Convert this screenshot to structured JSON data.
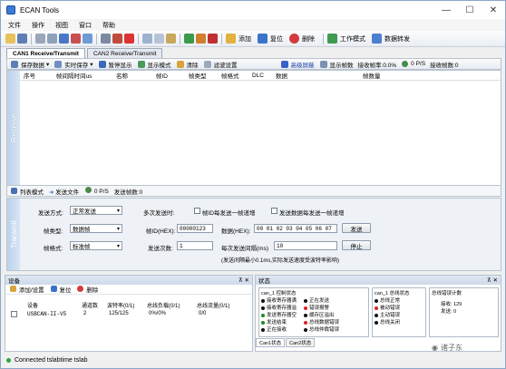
{
  "window": {
    "title": "ECAN Tools"
  },
  "menu": [
    "文件",
    "操作",
    "视图",
    "窗口",
    "帮助"
  ],
  "toolbar": {
    "add": "添加",
    "reset": "复位",
    "delete": "删除",
    "work_mode": "工作模式",
    "data_forward": "数据转发"
  },
  "tabs": [
    "CAN1 Receive/Transmit",
    "CAN2 Receive/Transmit"
  ],
  "rx_toolbar": {
    "save_data": "保存数据",
    "realtime_save": "实时保存",
    "pause_display": "暂停显示",
    "display_mode": "显示模式",
    "clear": "清除",
    "filter_settings": "滤波设置",
    "advanced_filter": "高级屏蔽",
    "display_frame": "显示帧数",
    "recv_fps": "接收帧率:0.0%",
    "rate": "0 P/S",
    "recv_count": "接收帧数:0"
  },
  "rx_side_label": "Receive",
  "rx_columns": [
    "序号",
    "帧间隔时间us",
    "名称",
    "帧ID",
    "帧类型",
    "帧格式",
    "DLC",
    "数据",
    "帧数量"
  ],
  "rx_status": {
    "list_mode": "列表模式",
    "send_file": "发送文件",
    "rate": "0 P/S",
    "send_count": "发送帧数:0"
  },
  "tx": {
    "side_label": "Transmit",
    "send_mode_label": "发送方式:",
    "send_mode_value": "正常发送",
    "multi_send_label": "多次发送时:",
    "chk_id_inc": "帧ID每发送一帧递增",
    "chk_data_inc": "发送数据每发送一帧递增",
    "frame_type_label": "帧类型:",
    "frame_type_value": "数据帧",
    "frame_id_label": "帧ID(HEX):",
    "frame_id_value": "00000123",
    "data_label": "数据(HEX):",
    "data_value": "00 01 02 03 04 05 06 07",
    "send_button": "发送",
    "frame_format_label": "帧格式:",
    "frame_format_value": "标准帧",
    "send_times_label": "发送次数:",
    "send_times_value": "1",
    "interval_label": "每次发送间隔(ms)",
    "interval_value": "10",
    "stop_button": "停止",
    "note": "(发送间隔最小0.1ms,实际发送速度受波特率影响)"
  },
  "device_pane": {
    "title": "设备",
    "add_settings": "添加/设置",
    "reset": "复位",
    "delete": "删除",
    "columns": [
      "设备",
      "通道数",
      "波特率(0/1)",
      "总线负载(0/1)",
      "总线流量(0/1)"
    ],
    "row": [
      "USBCAN-II-V5",
      "2",
      "125/125",
      "0%/0%",
      "0/0"
    ]
  },
  "status_pane": {
    "title": "状态",
    "ctrl_title": "can_1 控制状态",
    "ctrl_left": [
      "接收寄存器满",
      "接收寄存器溢",
      "发送寄存器空",
      "发送结束",
      "正在接收"
    ],
    "ctrl_right": [
      "正在发送",
      "错误报警",
      "缓存区溢出",
      "总线数据错误",
      "总线仲裁错误"
    ],
    "bus_title": "can_1 总线状态",
    "bus_items": [
      "总线正常",
      "被动错误",
      "主动错误",
      "总线关闭"
    ],
    "err_title": "总线错误计数",
    "recv_label": "接收:",
    "recv_value": "129",
    "send_label": "发送:",
    "send_value": "0",
    "tabs": [
      "Can1状态",
      "Can2状态"
    ]
  },
  "statusbar": {
    "text": "Connected  tslabtime  tslab"
  },
  "watermark": "诸子东"
}
